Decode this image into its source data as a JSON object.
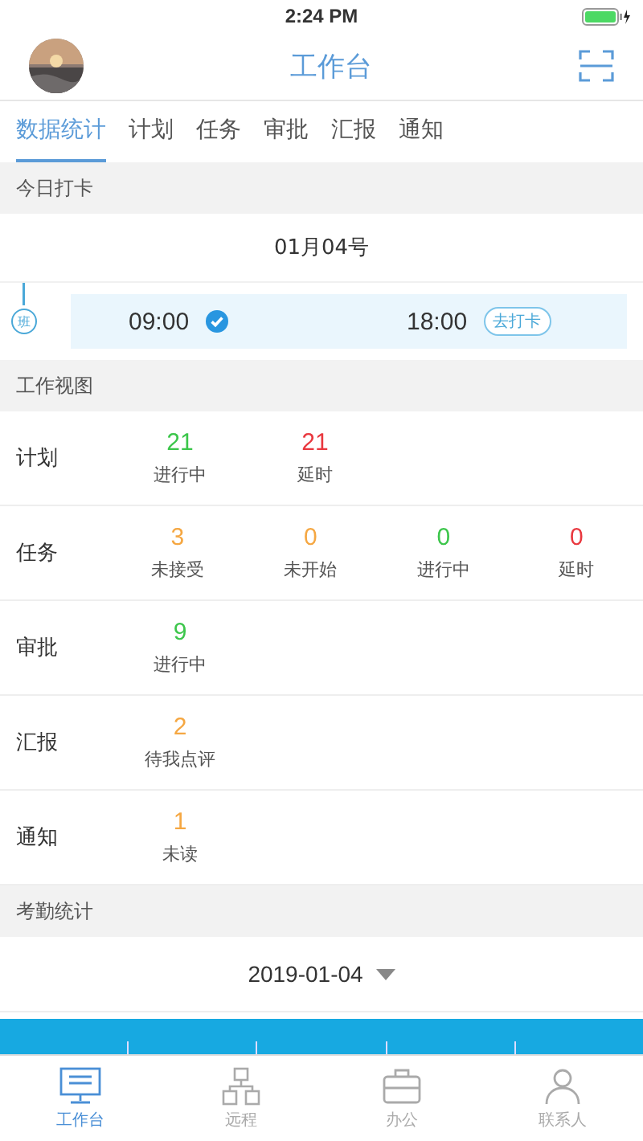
{
  "status_bar": {
    "time": "2:24 PM"
  },
  "header": {
    "title": "工作台"
  },
  "tabs": [
    {
      "label": "数据统计",
      "selected": true
    },
    {
      "label": "计划",
      "selected": false
    },
    {
      "label": "任务",
      "selected": false
    },
    {
      "label": "审批",
      "selected": false
    },
    {
      "label": "汇报",
      "selected": false
    },
    {
      "label": "通知",
      "selected": false
    }
  ],
  "checkin": {
    "title": "今日打卡",
    "date": "01月04号",
    "shift_label": "班",
    "punches": [
      {
        "time": "09:00",
        "checked": true
      },
      {
        "time": "18:00",
        "checked": false,
        "action": "去打卡"
      }
    ]
  },
  "work_view": {
    "title": "工作视图",
    "rows": [
      {
        "label": "计划",
        "stats": [
          {
            "value": "21",
            "caption": "进行中",
            "color": "#3cc64b"
          },
          {
            "value": "21",
            "caption": "延时",
            "color": "#e9383f"
          }
        ]
      },
      {
        "label": "任务",
        "stats": [
          {
            "value": "3",
            "caption": "未接受",
            "color": "#f5a742"
          },
          {
            "value": "0",
            "caption": "未开始",
            "color": "#f5a742"
          },
          {
            "value": "0",
            "caption": "进行中",
            "color": "#3cc64b"
          },
          {
            "value": "0",
            "caption": "延时",
            "color": "#e9383f"
          }
        ]
      },
      {
        "label": "审批",
        "stats": [
          {
            "value": "9",
            "caption": "进行中",
            "color": "#3cc64b"
          }
        ]
      },
      {
        "label": "汇报",
        "stats": [
          {
            "value": "2",
            "caption": "待我点评",
            "color": "#f5a742"
          }
        ]
      },
      {
        "label": "通知",
        "stats": [
          {
            "value": "1",
            "caption": "未读",
            "color": "#f5a742"
          }
        ]
      }
    ]
  },
  "attendance": {
    "title": "考勤统计",
    "date": "2019-01-04"
  },
  "tab_bar": [
    {
      "label": "工作台",
      "selected": true,
      "kind": "monitor"
    },
    {
      "label": "远程",
      "selected": false,
      "kind": "network"
    },
    {
      "label": "办公",
      "selected": false,
      "kind": "briefcase"
    },
    {
      "label": "联系人",
      "selected": false,
      "kind": "person"
    }
  ]
}
